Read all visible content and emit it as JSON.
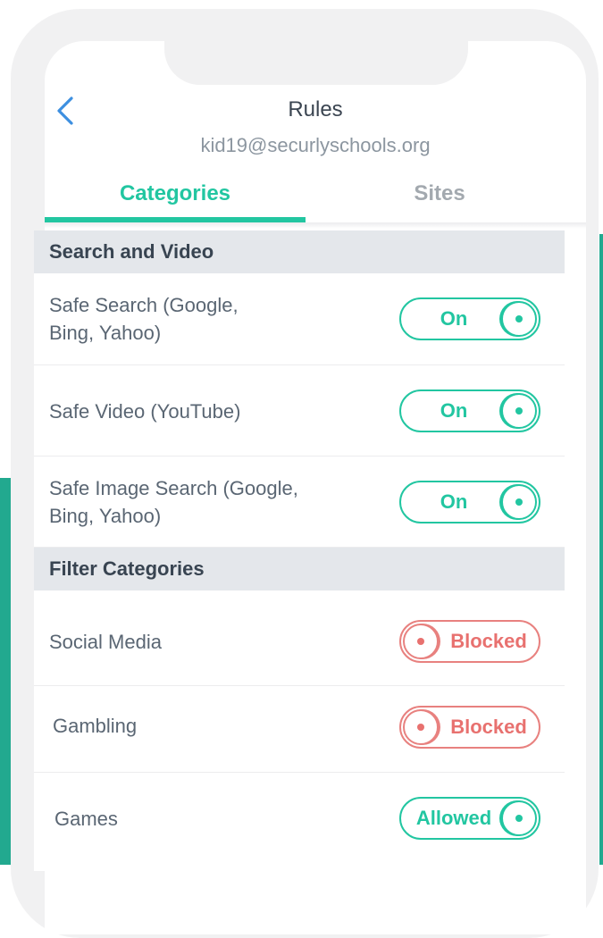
{
  "colors": {
    "accent": "#22c6a1",
    "blocked": "#e8716f",
    "section_bg": "#e4e7eb",
    "frame_teal": "#22a98f"
  },
  "header": {
    "back_icon": "chevron-left-icon",
    "title": "Rules",
    "subtitle": "kid19@securlyschools.org"
  },
  "tabs": [
    {
      "label": "Categories",
      "active": true
    },
    {
      "label": "Sites",
      "active": false
    }
  ],
  "sections": [
    {
      "title": "Search and Video",
      "rows": [
        {
          "label_lines": [
            "Safe Search (Google,",
            "Bing, Yahoo)"
          ],
          "state": "On"
        },
        {
          "label_lines": [
            "Safe Video (YouTube)"
          ],
          "state": "On"
        },
        {
          "label_lines": [
            "Safe Image Search (Google,",
            "Bing, Yahoo)"
          ],
          "state": "On"
        }
      ]
    },
    {
      "title": "Filter Categories",
      "rows": [
        {
          "label_lines": [
            "Social Media"
          ],
          "state": "Blocked"
        },
        {
          "label_lines": [
            "Gambling"
          ],
          "state": "Blocked"
        },
        {
          "label_lines": [
            "Games"
          ],
          "state": "Allowed"
        }
      ]
    }
  ]
}
